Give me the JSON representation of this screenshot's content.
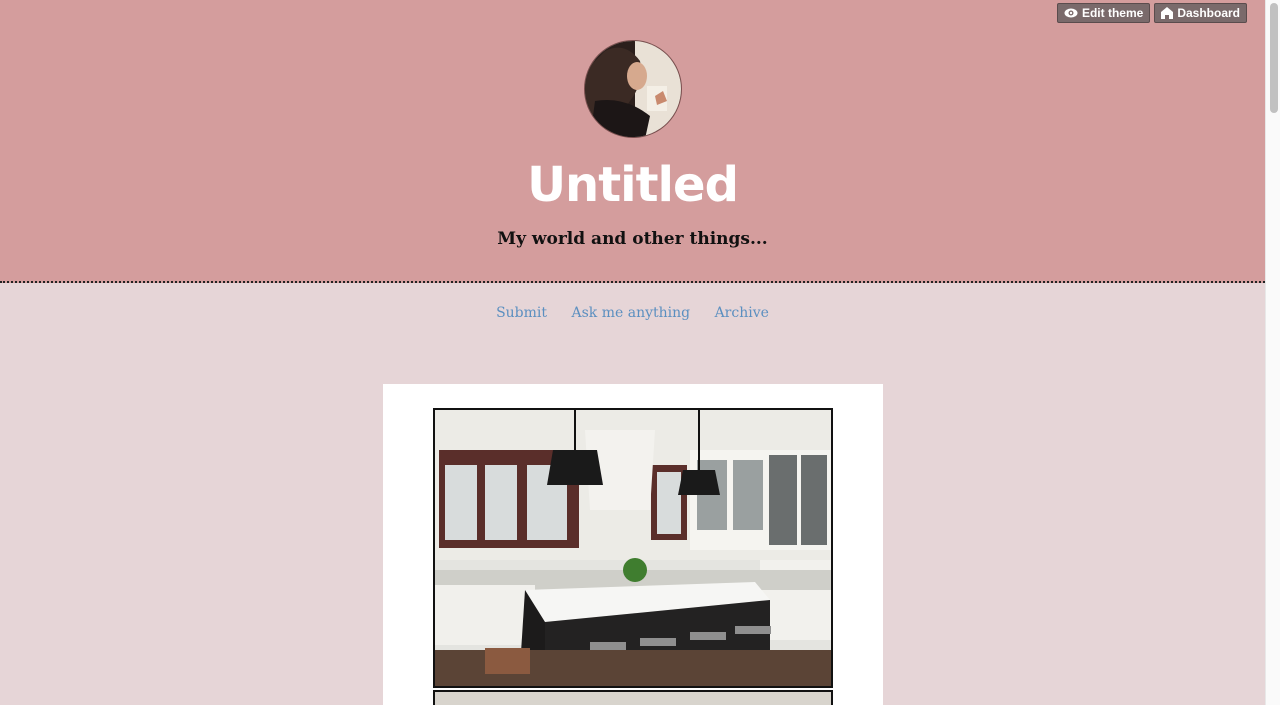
{
  "header": {
    "blog_title": "Untitled",
    "description": "My world and other things..."
  },
  "nav": {
    "items": [
      "Submit",
      "Ask me anything",
      "Archive"
    ]
  },
  "controls": {
    "edit_theme": "Edit theme",
    "dashboard": "Dashboard"
  },
  "colors": {
    "header_bg": "#d49d9d",
    "page_bg": "#e6d5d7",
    "link": "#5b8fc0"
  }
}
